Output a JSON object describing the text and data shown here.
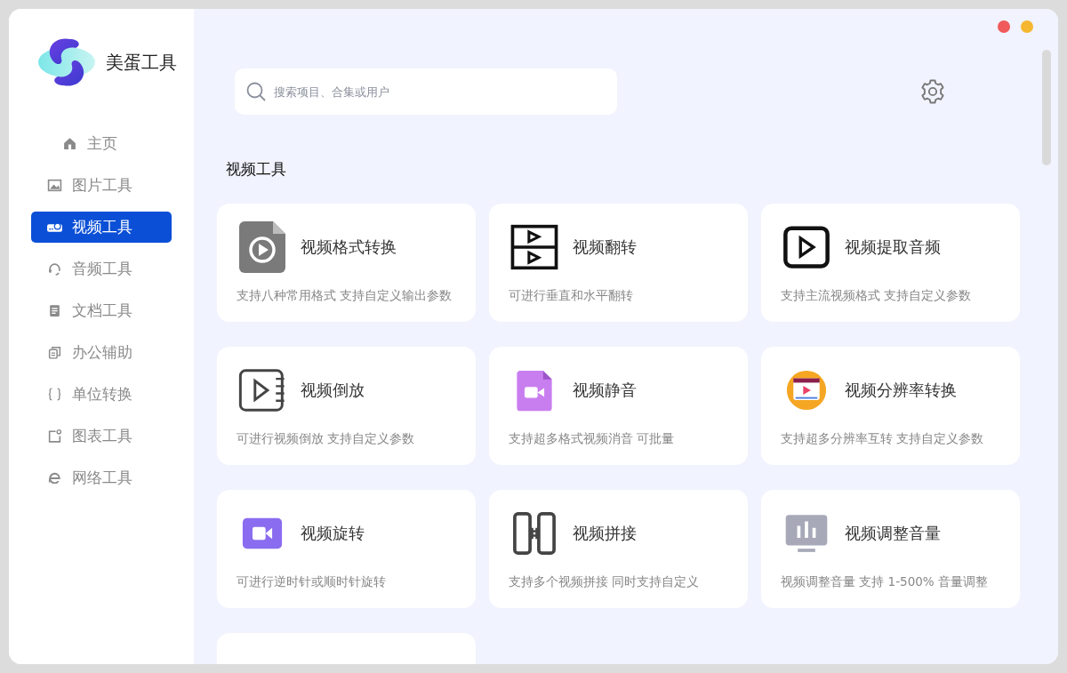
{
  "app": {
    "name": "美蛋工具"
  },
  "sidebar": {
    "items": [
      {
        "label": "主页",
        "selected": false
      },
      {
        "label": "图片工具",
        "selected": false
      },
      {
        "label": "视频工具",
        "selected": true
      },
      {
        "label": "音频工具",
        "selected": false
      },
      {
        "label": "文档工具",
        "selected": false
      },
      {
        "label": "办公辅助",
        "selected": false
      },
      {
        "label": "单位转换",
        "selected": false
      },
      {
        "label": "图表工具",
        "selected": false
      },
      {
        "label": "网络工具",
        "selected": false
      }
    ]
  },
  "search": {
    "placeholder": "搜索项目、合集或用户"
  },
  "section": {
    "title": "视频工具"
  },
  "cards": [
    {
      "kind": "tool",
      "title": "视频格式转换",
      "description": "支持八种常用格式 支持自定义输出参数"
    },
    {
      "kind": "tool",
      "title": "视频翻转",
      "description": "可进行垂直和水平翻转"
    },
    {
      "kind": "tool",
      "title": "视频提取音频",
      "description": "支持主流视频格式 支持自定义参数"
    },
    {
      "kind": "tool",
      "title": "视频倒放",
      "description": "可进行视频倒放 支持自定义参数"
    },
    {
      "kind": "tool",
      "title": "视频静音",
      "description": "支持超多格式视频消音 可批量"
    },
    {
      "kind": "tool",
      "title": "视频分辨率转换",
      "description": "支持超多分辨率互转 支持自定义参数"
    },
    {
      "kind": "tool",
      "title": "视频旋转",
      "description": "可进行逆时针或顺时针旋转"
    },
    {
      "kind": "tool",
      "title": "视频拼接",
      "description": "支持多个视频拼接 同时支持自定义"
    },
    {
      "kind": "tool",
      "title": "视频调整音量",
      "description": "视频调整音量 支持 1-500% 音量调整"
    },
    {
      "kind": "empty"
    }
  ]
}
